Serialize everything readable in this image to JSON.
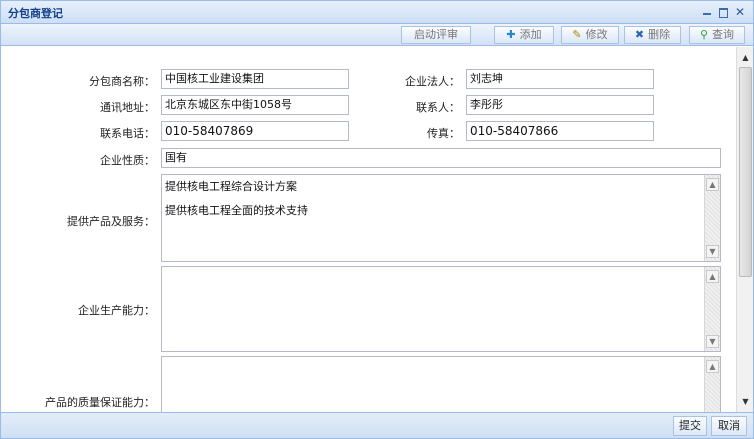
{
  "window": {
    "title": "分包商登记"
  },
  "toolbar": {
    "evaluate_label": "启动评审",
    "add_label": "添加",
    "edit_label": "修改",
    "delete_label": "删除",
    "search_label": "查询"
  },
  "form": {
    "subcontractor_name": {
      "label": "分包商名称：",
      "value": "中国核工业建设集团"
    },
    "legal_person": {
      "label": "企业法人：",
      "value": "刘志坤"
    },
    "address": {
      "label": "通讯地址：",
      "value": "北京东城区东中街1058号"
    },
    "contact_person": {
      "label": "联系人：",
      "value": "李彤彤"
    },
    "phone": {
      "label": "联系电话：",
      "value": "010-58407869"
    },
    "fax": {
      "label": "传真：",
      "value": "010-58407866"
    },
    "nature": {
      "label": "企业性质：",
      "value": "国有"
    },
    "products": {
      "label": "提供产品及服务：",
      "lines": [
        "提供核电工程综合设计方案",
        "提供核电工程全面的技术支持"
      ]
    },
    "capacity": {
      "label": "企业生产能力：",
      "value": ""
    },
    "quality": {
      "label": "产品的质量保证能力：",
      "value": ""
    }
  },
  "footer": {
    "submit_label": "提交",
    "cancel_label": "取消"
  }
}
